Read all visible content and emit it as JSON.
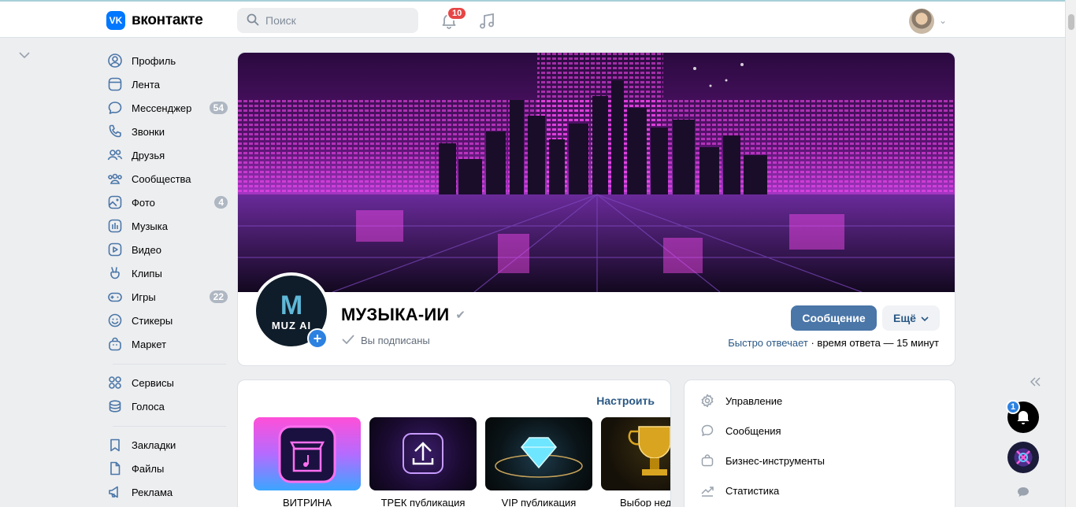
{
  "header": {
    "logo_text": "вконтакте",
    "logo_mark": "VK",
    "search_placeholder": "Поиск",
    "notifications_count": "10"
  },
  "sidebar": {
    "items": [
      {
        "label": "Профиль",
        "icon": "profile-icon"
      },
      {
        "label": "Лента",
        "icon": "feed-icon"
      },
      {
        "label": "Мессенджер",
        "icon": "messenger-icon",
        "count": "54"
      },
      {
        "label": "Звонки",
        "icon": "phone-icon"
      },
      {
        "label": "Друзья",
        "icon": "friends-icon"
      },
      {
        "label": "Сообщества",
        "icon": "communities-icon"
      },
      {
        "label": "Фото",
        "icon": "photo-icon",
        "count": "4"
      },
      {
        "label": "Музыка",
        "icon": "music-icon"
      },
      {
        "label": "Видео",
        "icon": "video-icon"
      },
      {
        "label": "Клипы",
        "icon": "clips-icon"
      },
      {
        "label": "Игры",
        "icon": "games-icon",
        "count": "22"
      },
      {
        "label": "Стикеры",
        "icon": "stickers-icon"
      },
      {
        "label": "Маркет",
        "icon": "market-icon"
      }
    ],
    "items2": [
      {
        "label": "Сервисы",
        "icon": "services-icon"
      },
      {
        "label": "Голоса",
        "icon": "votes-icon"
      }
    ],
    "items3": [
      {
        "label": "Закладки",
        "icon": "bookmark-icon"
      },
      {
        "label": "Файлы",
        "icon": "files-icon"
      },
      {
        "label": "Реклама",
        "icon": "ads-icon"
      }
    ]
  },
  "group": {
    "name": "МУЗЫКА-ИИ",
    "avatar_text": "MUZ AI",
    "avatar_letter": "M",
    "subscribed_text": "Вы подписаны",
    "message_button": "Сообщение",
    "more_button": "Ещё",
    "reply_fast": "Быстро отвечает",
    "reply_separator": " · ",
    "reply_time": "время ответа — 15 минут"
  },
  "showcase": {
    "configure_label": "Настроить",
    "tiles": [
      {
        "label": "ВИТРИНА"
      },
      {
        "label": "ТРЕК публикация"
      },
      {
        "label": "VIP публикация"
      },
      {
        "label": "Выбор нед"
      }
    ]
  },
  "manage_menu": {
    "items": [
      {
        "label": "Управление",
        "icon": "gear-icon"
      },
      {
        "label": "Сообщения",
        "icon": "message-icon"
      },
      {
        "label": "Бизнес-инструменты",
        "icon": "briefcase-icon"
      },
      {
        "label": "Статистика",
        "icon": "stats-icon"
      }
    ]
  },
  "floating": {
    "badge_count": "1"
  },
  "colors": {
    "accent": "#4a76a8",
    "link": "#2a5885",
    "badge_red": "#e64646",
    "badge_gray": "#aeb7c2",
    "background": "#edeef0"
  }
}
